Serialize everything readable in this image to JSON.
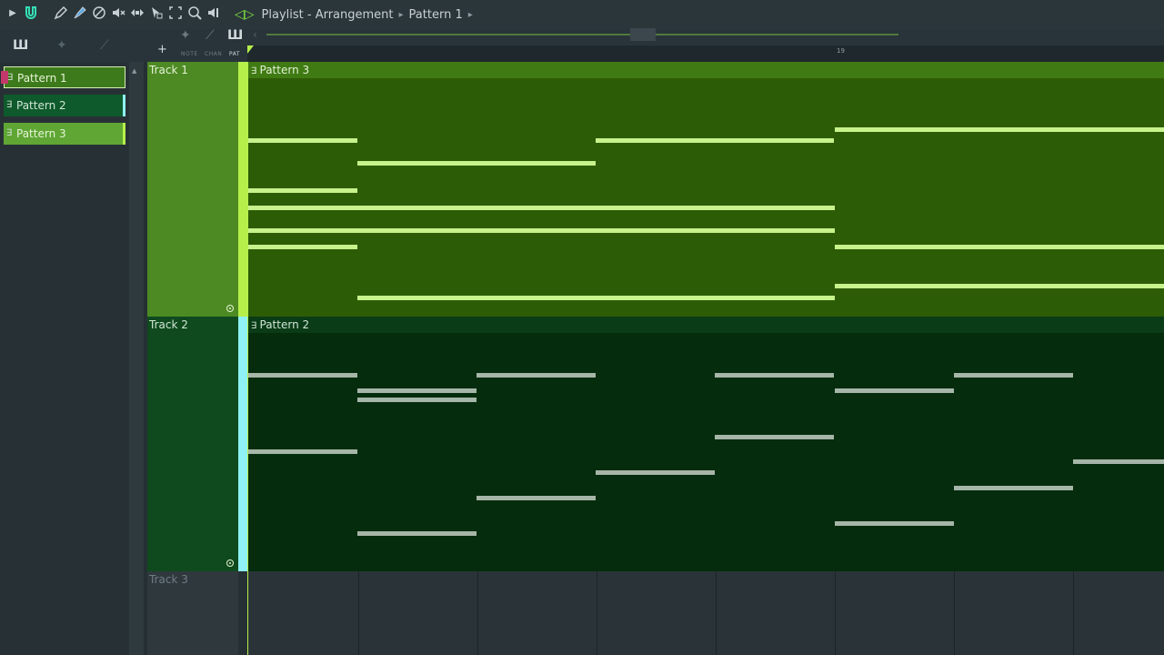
{
  "toolbar": {
    "icons": [
      "play-arrow-icon",
      "magnet-icon",
      "pencil-icon",
      "paint-brush-icon",
      "delete-icon",
      "mute-icon",
      "slip-icon",
      "select-icon",
      "zoom-box-icon",
      "zoom-icon",
      "playback-icon",
      "play-green-icon"
    ],
    "title": "Playlist - Arrangement",
    "breadcrumb_pattern": "Pattern 1"
  },
  "modes": {
    "note": "NOTE",
    "chan": "CHAN",
    "pat": "PAT",
    "add": "+"
  },
  "ruler": {
    "bar_marker": "19"
  },
  "patterns": [
    {
      "label": "Pattern 1",
      "color": "#6fb33a"
    },
    {
      "label": "Pattern 2",
      "color": "#0f5a2c"
    },
    {
      "label": "Pattern 3",
      "color": "#5fa634"
    }
  ],
  "tracks": [
    {
      "name": "Track 1",
      "clip_label": "Pattern 3",
      "color": "#2d5c06"
    },
    {
      "name": "Track 2",
      "clip_label": "Pattern 2",
      "color": "#042c0d"
    },
    {
      "name": "Track 3",
      "clip_label": "",
      "color": "#2a3438"
    }
  ],
  "colors": {
    "accent_green": "#b6ef4a",
    "accent_cyan": "#8ff0f6",
    "note_light": "#c7f28c",
    "note_gray": "#a6b6a8"
  }
}
